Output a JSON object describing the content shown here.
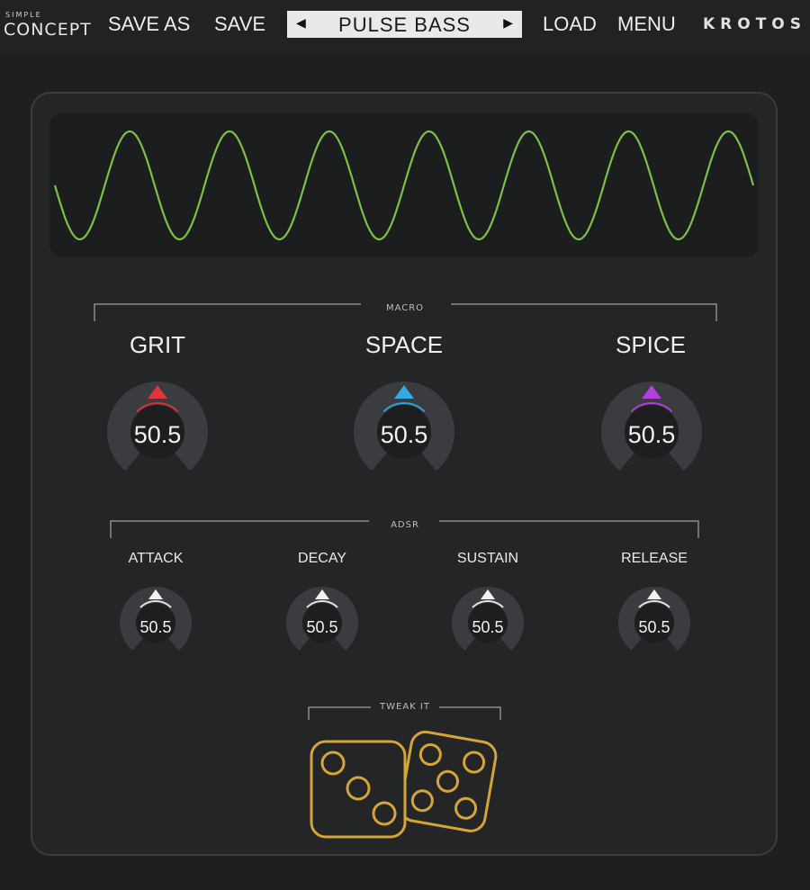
{
  "header": {
    "logo_small": "SIMPLE",
    "logo_big": "CONCEPT",
    "save_as": "SAVE AS",
    "save": "SAVE",
    "preset_name": "PULSE BASS",
    "prev_arrow": "◀",
    "next_arrow": "▶",
    "load": "LOAD",
    "menu": "MENU",
    "brand": "KROTOS"
  },
  "waveform": {
    "color": "#7cc142",
    "cycles": 7
  },
  "macro": {
    "label": "MACRO",
    "knobs": [
      {
        "label": "GRIT",
        "value": "50.5",
        "color": "#e2333c"
      },
      {
        "label": "SPACE",
        "value": "50.5",
        "color": "#33a9e6"
      },
      {
        "label": "SPICE",
        "value": "50.5",
        "color": "#b73fe0"
      }
    ]
  },
  "adsr": {
    "label": "ADSR",
    "knobs": [
      {
        "label": "ATTACK",
        "value": "50.5"
      },
      {
        "label": "DECAY",
        "value": "50.5"
      },
      {
        "label": "SUSTAIN",
        "value": "50.5"
      },
      {
        "label": "RELEASE",
        "value": "50.5"
      }
    ]
  },
  "tweak": {
    "label": "TWEAK IT",
    "icon": "dice-icon",
    "color": "#d6a437"
  }
}
